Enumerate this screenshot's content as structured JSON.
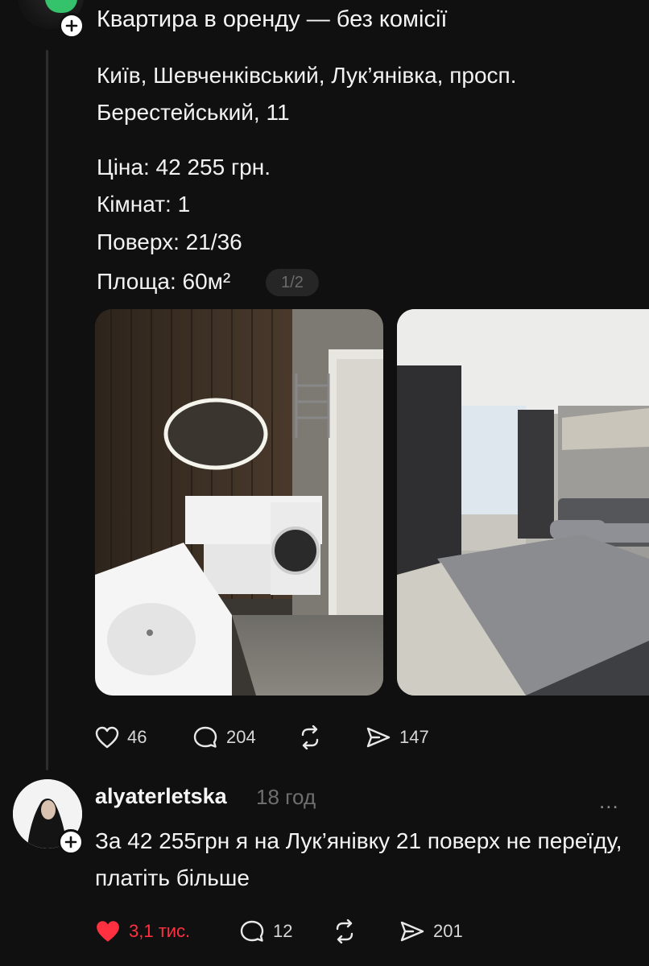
{
  "post": {
    "title": "Квартира в оренду — без комісії",
    "address_line1": "Київ, Шевченківський, Лук’янівка, просп.",
    "address_line2": "Берестейський, 11",
    "price": "Ціна: 42 255 грн.",
    "rooms": "Кімнат: 1",
    "floor": "Поверх: 21/36",
    "area": "Площа: 60м²",
    "photo_counter": "1/2",
    "likes": "46",
    "comments": "204",
    "shares": "147"
  },
  "reply": {
    "username": "alyaterletska",
    "time": "18 год",
    "more_icon": "...",
    "text": "За 42 255грн я на Лук’янівку 21 поверх не переїду, платіть більше",
    "likes": "3,1 тис.",
    "comments": "12",
    "shares": "201",
    "like_color": "#ff3040"
  }
}
